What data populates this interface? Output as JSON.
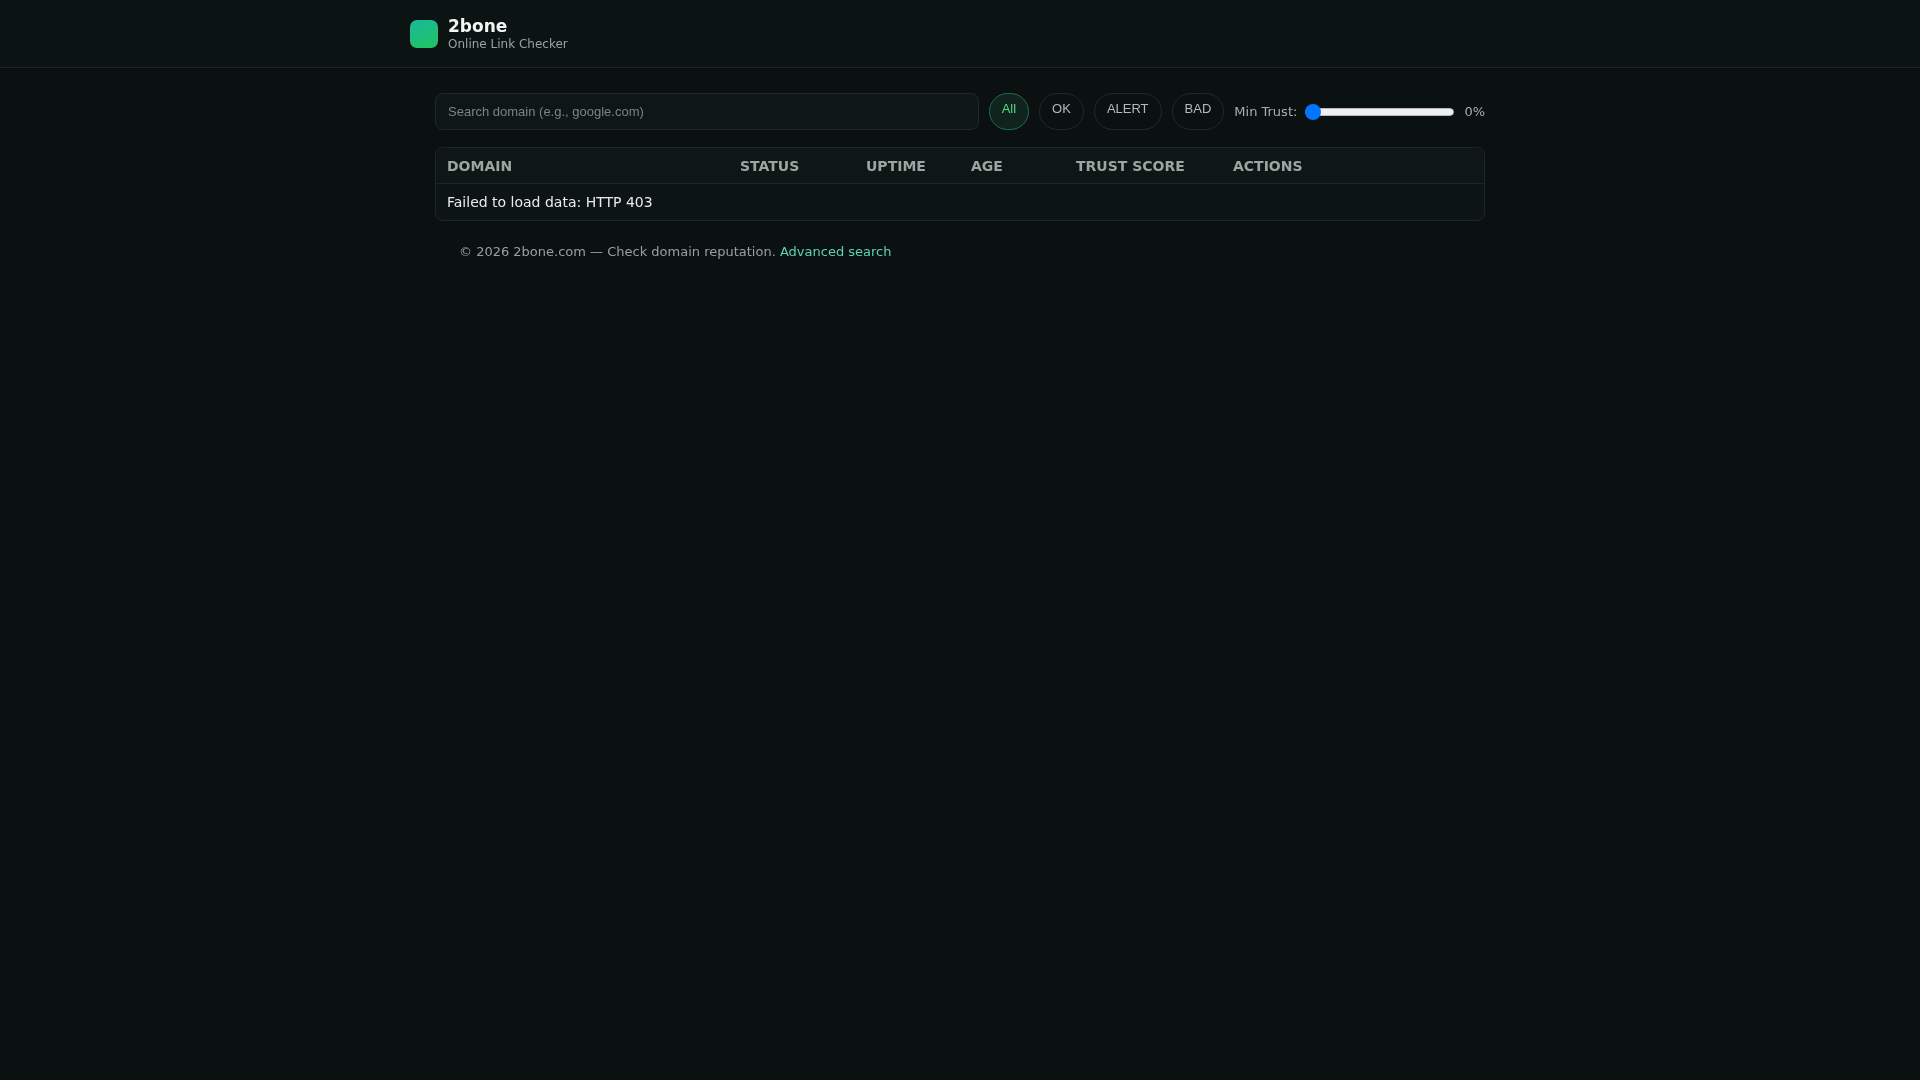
{
  "header": {
    "brand": "2bone",
    "tagline": "Online Link Checker"
  },
  "toolbar": {
    "search": {
      "placeholder": "Search domain (e.g., google.com)"
    },
    "filters": [
      {
        "label": "All",
        "selected": true
      },
      {
        "label": "OK",
        "selected": false
      },
      {
        "label": "ALERT",
        "selected": false
      },
      {
        "label": "BAD",
        "selected": false
      }
    ],
    "trust_slider": {
      "label": "Min Trust:",
      "level": 0,
      "reading": "0%"
    }
  },
  "table": {
    "columns": [
      "DOMAIN",
      "STATUS",
      "UPTIME",
      "AGE",
      "TRUST SCORE",
      "ACTIONS"
    ],
    "message": "Failed to load data: HTTP 403"
  },
  "footer": {
    "text": "© 2026 2bone.com — Check domain reputation.",
    "link": "Advanced search"
  }
}
